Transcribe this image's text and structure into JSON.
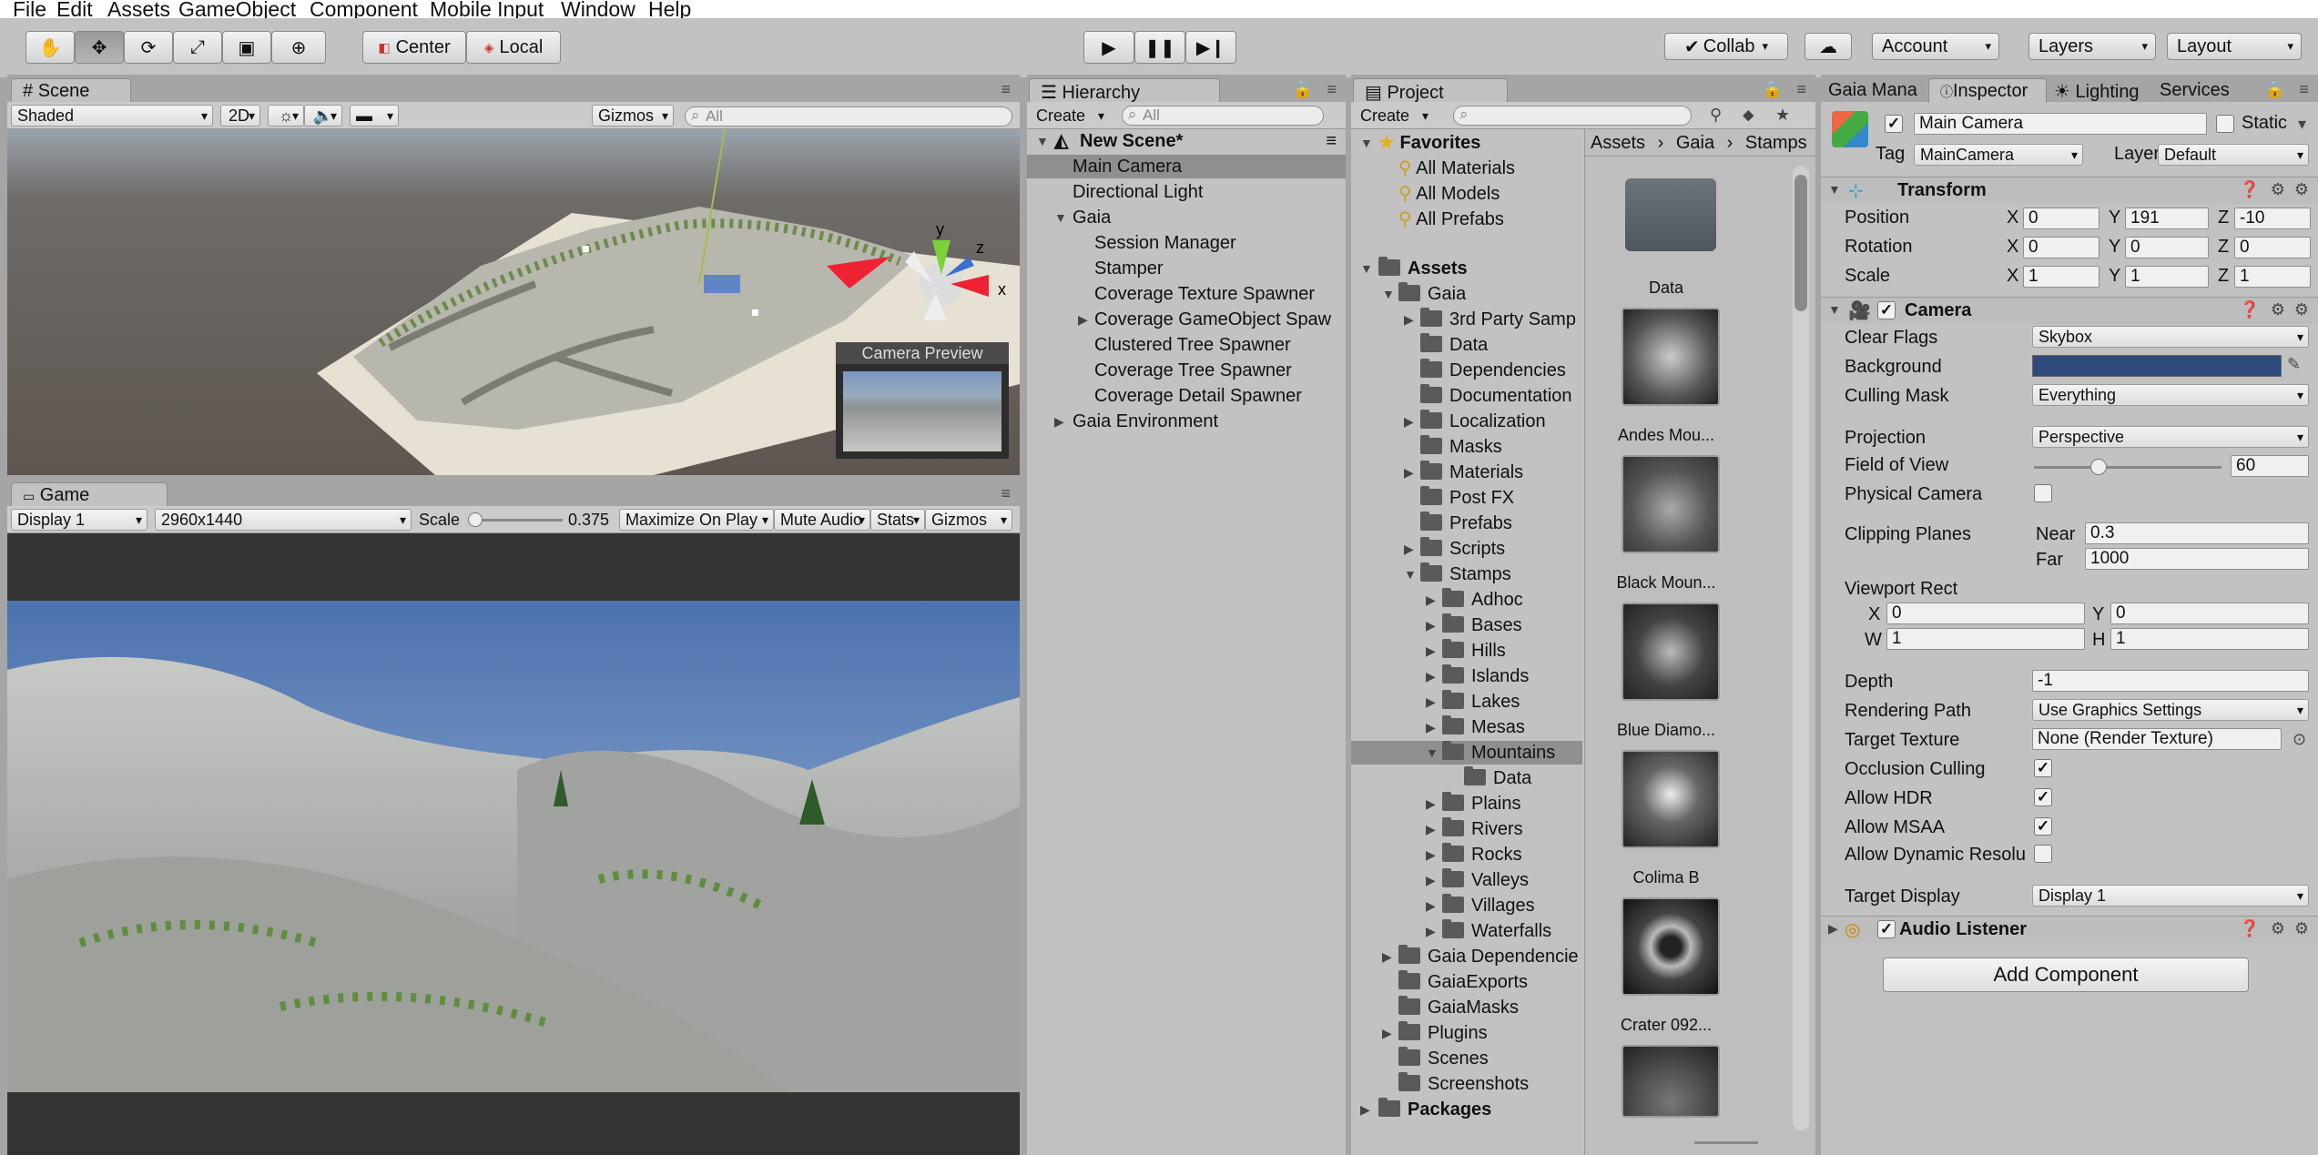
{
  "menu": [
    "File",
    "Edit",
    "Assets",
    "GameObject",
    "Component",
    "Mobile Input",
    "Window",
    "Help"
  ],
  "toolbar": {
    "pivot_center": "Center",
    "pivot_local": "Local",
    "collab": "Collab",
    "account": "Account",
    "layers": "Layers",
    "layout": "Layout"
  },
  "scene": {
    "tab": "Scene",
    "shading": "Shaded",
    "mode_2d": "2D",
    "gizmos": "Gizmos",
    "search_placeholder": "All",
    "camera_preview": "Camera Preview",
    "axis_y": "y",
    "axis_x": "x",
    "axis_z": "z"
  },
  "game": {
    "tab": "Game",
    "display": "Display 1",
    "resolution": "2960x1440",
    "scale_label": "Scale",
    "scale_value": "0.375",
    "maximize": "Maximize On Play",
    "mute": "Mute Audio",
    "stats": "Stats",
    "gizmos": "Gizmos"
  },
  "hierarchy": {
    "tab": "Hierarchy",
    "create": "Create",
    "search_placeholder": "All",
    "scene_name": "New Scene*",
    "items": [
      {
        "label": "Main Camera",
        "selected": true
      },
      {
        "label": "Directional Light"
      },
      {
        "label": "Gaia"
      },
      {
        "label": "Session Manager"
      },
      {
        "label": "Stamper"
      },
      {
        "label": "Coverage Texture Spawner"
      },
      {
        "label": "Coverage GameObject Spaw"
      },
      {
        "label": "Clustered Tree Spawner"
      },
      {
        "label": "Coverage Tree Spawner"
      },
      {
        "label": "Coverage Detail Spawner"
      },
      {
        "label": "Gaia Environment"
      }
    ]
  },
  "project": {
    "tab": "Project",
    "create": "Create",
    "favorites": "Favorites",
    "fav_items": [
      "All Materials",
      "All Models",
      "All Prefabs"
    ],
    "assets": "Assets",
    "tree": [
      "Gaia",
      "3rd Party Samp",
      "Data",
      "Dependencies",
      "Documentation",
      "Localization",
      "Masks",
      "Materials",
      "Post FX",
      "Prefabs",
      "Scripts",
      "Stamps",
      "Adhoc",
      "Bases",
      "Hills",
      "Islands",
      "Lakes",
      "Mesas",
      "Mountains",
      "Data",
      "Plains",
      "Rivers",
      "Rocks",
      "Valleys",
      "Villages",
      "Waterfalls",
      "Gaia Dependencie",
      "GaiaExports",
      "GaiaMasks",
      "Plugins",
      "Scenes",
      "Screenshots"
    ],
    "packages": "Packages",
    "breadcrumb": [
      "Assets",
      "Gaia",
      "Stamps"
    ],
    "thumbs": [
      "Data",
      "Andes Mou...",
      "Black Moun...",
      "Blue Diamo...",
      "Colima B",
      "Crater 092..."
    ]
  },
  "inspector": {
    "tabs": [
      "Gaia Mana",
      "Inspector",
      "Lighting",
      "Services"
    ],
    "object_name": "Main Camera",
    "static_label": "Static",
    "tag_label": "Tag",
    "tag_value": "MainCamera",
    "layer_label": "Layer",
    "layer_value": "Default",
    "transform": {
      "title": "Transform",
      "position_label": "Position",
      "px": "0",
      "py": "191",
      "pz": "-10",
      "rotation_label": "Rotation",
      "rx": "0",
      "ry": "0",
      "rz": "0",
      "scale_label": "Scale",
      "sx": "1",
      "sy": "1",
      "sz": "1"
    },
    "camera": {
      "title": "Camera",
      "clear_flags_label": "Clear Flags",
      "clear_flags": "Skybox",
      "background_label": "Background",
      "culling_label": "Culling Mask",
      "culling": "Everything",
      "projection_label": "Projection",
      "projection": "Perspective",
      "fov_label": "Field of View",
      "fov": "60",
      "physical_label": "Physical Camera",
      "clipping_label": "Clipping Planes",
      "near_label": "Near",
      "near": "0.3",
      "far_label": "Far",
      "far": "1000",
      "viewport_label": "Viewport Rect",
      "vx": "0",
      "vy": "0",
      "vw": "1",
      "vh": "1",
      "depth_label": "Depth",
      "depth": "-1",
      "rendering_label": "Rendering Path",
      "rendering": "Use Graphics Settings",
      "target_tex_label": "Target Texture",
      "target_tex": "None (Render Texture)",
      "occlusion_label": "Occlusion Culling",
      "hdr_label": "Allow HDR",
      "msaa_label": "Allow MSAA",
      "dyn_label": "Allow Dynamic Resolu",
      "target_display_label": "Target Display",
      "target_display": "Display 1"
    },
    "audio_listener": "Audio Listener",
    "add_component": "Add Component"
  },
  "colors": {
    "background_swatch": "#2d4a7a",
    "selection": "#8f8f8f",
    "sky": "#6f93c2"
  }
}
